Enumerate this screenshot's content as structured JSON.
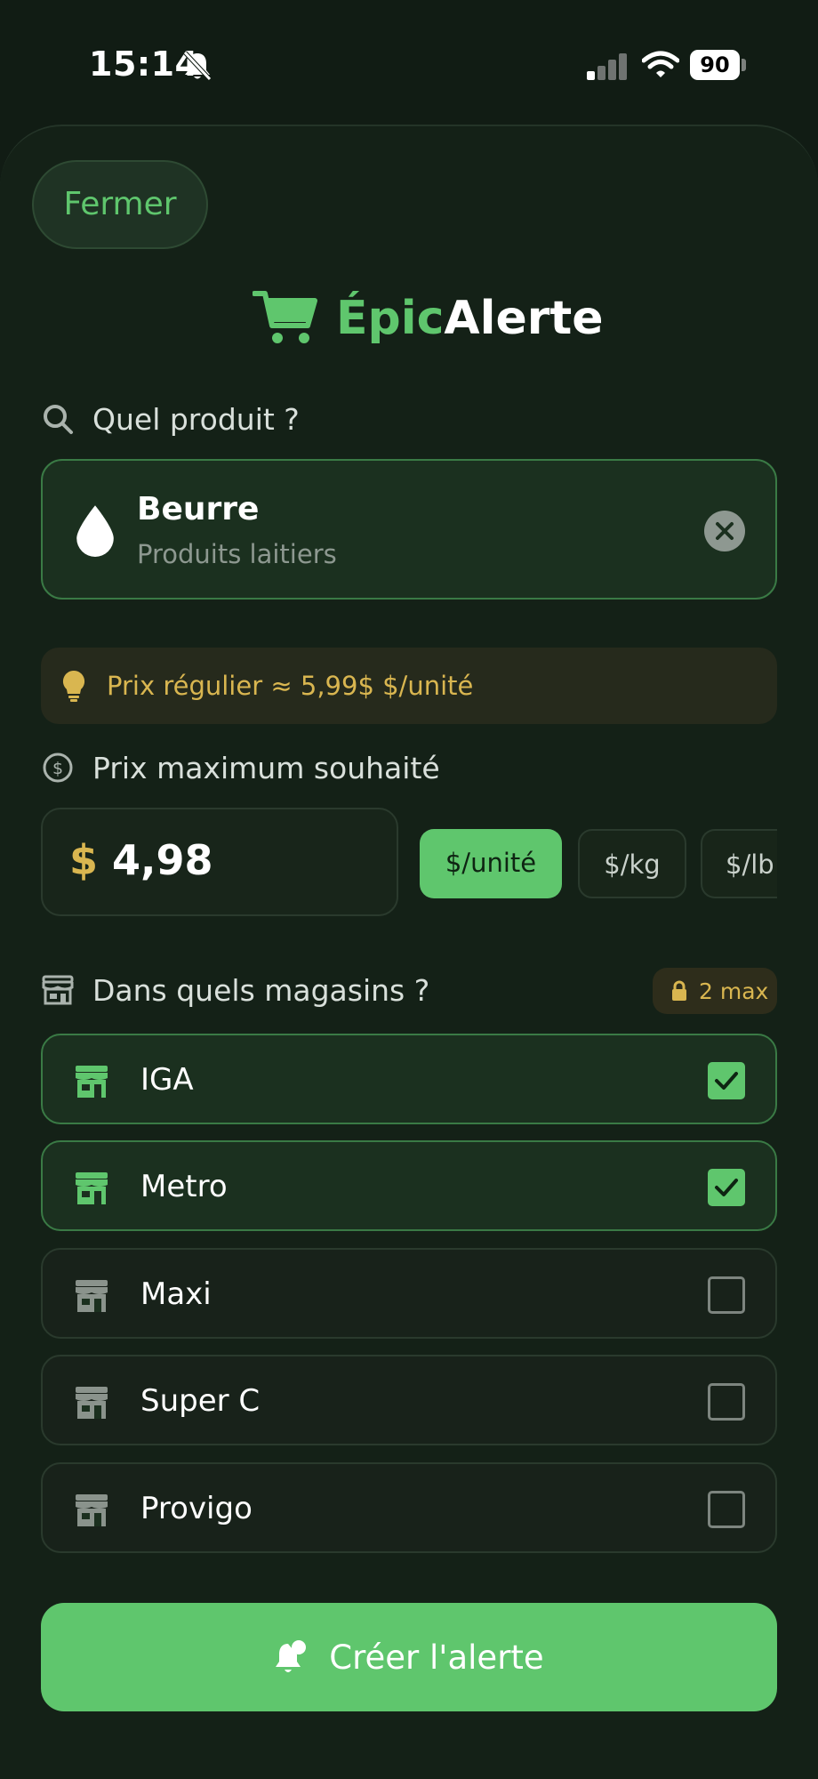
{
  "status_bar": {
    "time": "15:14",
    "battery": "90"
  },
  "header": {
    "close_label": "Fermer",
    "brand_part1": "Épic",
    "brand_part2": "Alerte"
  },
  "product": {
    "section_label": "Quel produit ?",
    "name": "Beurre",
    "category": "Produits laitiers"
  },
  "hint": {
    "text": "Prix régulier ≈ 5,99$ $/unité"
  },
  "price": {
    "section_label": "Prix maximum souhaité",
    "currency": "$",
    "value": "4,98",
    "units": [
      "$/unité",
      "$/kg",
      "$/lb"
    ]
  },
  "stores": {
    "section_label": "Dans quels magasins ?",
    "limit_badge": "2 max",
    "items": [
      {
        "name": "IGA",
        "checked": true
      },
      {
        "name": "Metro",
        "checked": true
      },
      {
        "name": "Maxi",
        "checked": false
      },
      {
        "name": "Super C",
        "checked": false
      },
      {
        "name": "Provigo",
        "checked": false
      }
    ]
  },
  "cta": {
    "label": "Créer l'alerte"
  },
  "colors": {
    "accent": "#5fc66d",
    "gold": "#d9b650",
    "background": "#111c14"
  }
}
